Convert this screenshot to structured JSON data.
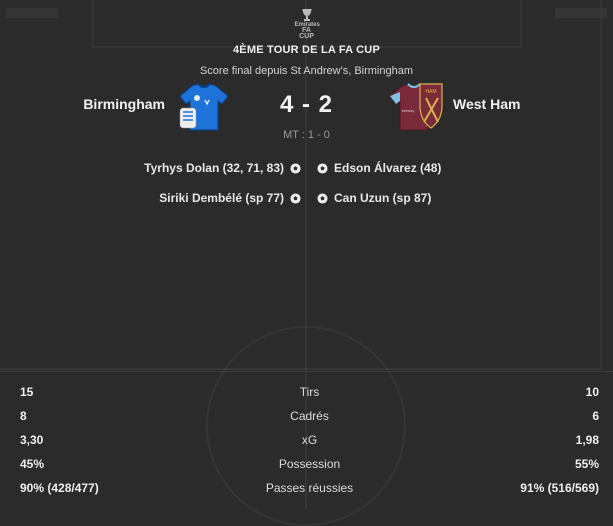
{
  "header": {
    "competition": "4ÈME TOUR DE LA FA CUP",
    "venue": "Score final depuis St Andrew's, Birmingham",
    "logo": {
      "icon": "fa-cup-trophy-icon",
      "line1": "Emirates",
      "line2": "FA CUP"
    }
  },
  "match": {
    "home_team": "Birmingham",
    "away_team": "West Ham",
    "score": "4 - 2",
    "halftime": "MT : 1 - 0",
    "home_color": "#1e73d8",
    "away_color": "#7a2a3b"
  },
  "scorers": {
    "home": [
      "Tyrhys Dolan (32, 71, 83)",
      "Siriki Dembélé (sp 77)"
    ],
    "away": [
      "Edson Álvarez (48)",
      "Can Uzun (sp 87)"
    ]
  },
  "stats": [
    {
      "label": "Tirs",
      "home": "15",
      "away": "10"
    },
    {
      "label": "Cadrés",
      "home": "8",
      "away": "6"
    },
    {
      "label": "xG",
      "home": "3,30",
      "away": "1,98"
    },
    {
      "label": "Possession",
      "home": "45%",
      "away": "55%"
    },
    {
      "label": "Passes réussies",
      "home": "90% (428/477)",
      "away": "91% (516/569)"
    }
  ]
}
